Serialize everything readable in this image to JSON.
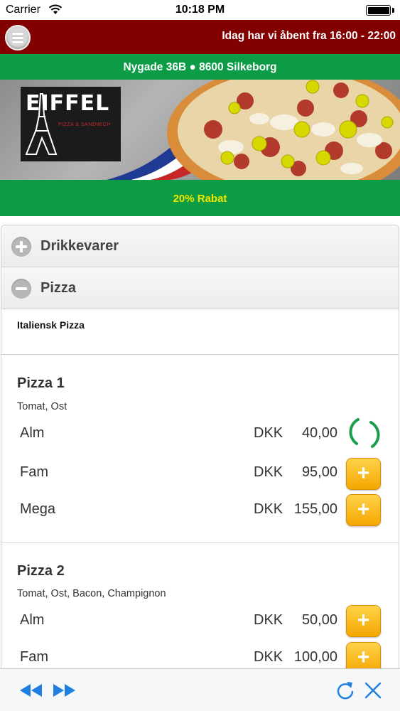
{
  "status_bar": {
    "carrier": "Carrier",
    "time": "10:18 PM"
  },
  "header": {
    "opening_hours": "Idag har vi åbent fra 16:00 - 22:00",
    "address": "Nygade 36B ● 8600 Silkeborg",
    "brand_color": "#820000",
    "accent_color": "#0b9c45"
  },
  "banner": {
    "logo_text": "EIFFEL",
    "logo_subtitle": "PIZZA & SANDWICH"
  },
  "discount": {
    "text": "20% Rabat",
    "color": "#f3e600"
  },
  "menu": {
    "sections": [
      {
        "label": "Drikkevarer",
        "expanded": false,
        "icon": "plus-circle-icon"
      },
      {
        "label": "Pizza",
        "expanded": true,
        "icon": "minus-circle-icon"
      }
    ],
    "category": "Italiensk Pizza",
    "products": [
      {
        "name": "Pizza 1",
        "description": "Tomat, Ost",
        "sizes": [
          {
            "label": "Alm",
            "currency": "DKK",
            "price": "40,00",
            "state": "loading"
          },
          {
            "label": "Fam",
            "currency": "DKK",
            "price": "95,00",
            "state": "add"
          },
          {
            "label": "Mega",
            "currency": "DKK",
            "price": "155,00",
            "state": "add"
          }
        ]
      },
      {
        "name": "Pizza 2",
        "description": "Tomat, Ost, Bacon, Champignon",
        "sizes": [
          {
            "label": "Alm",
            "currency": "DKK",
            "price": "50,00",
            "state": "add"
          },
          {
            "label": "Fam",
            "currency": "DKK",
            "price": "100,00",
            "state": "add"
          }
        ]
      }
    ],
    "add_symbol": "+"
  },
  "toolbar": {
    "icons": [
      "rewind-icon",
      "fast-forward-icon",
      "refresh-icon",
      "close-icon"
    ]
  }
}
